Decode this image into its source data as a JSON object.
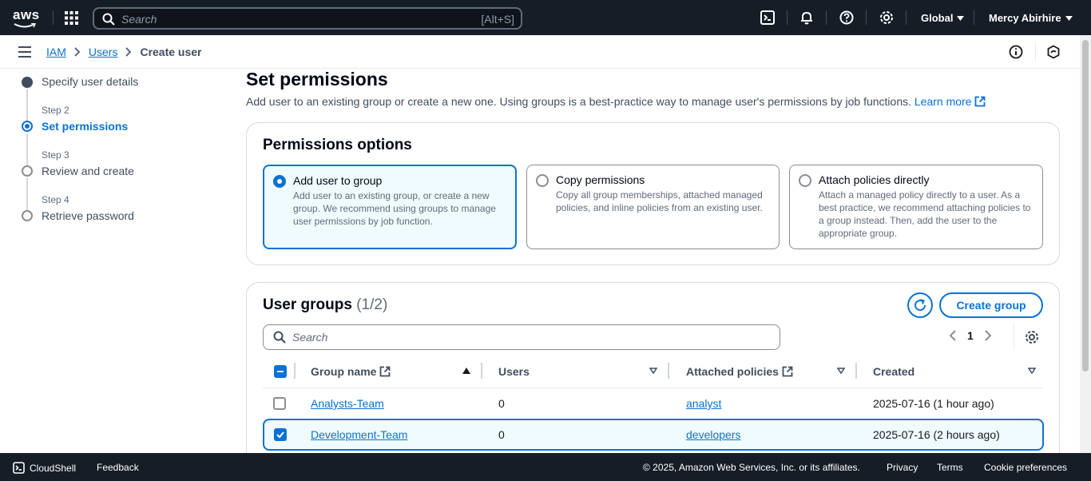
{
  "topnav": {
    "logo": "aws",
    "search_placeholder": "Search",
    "search_shortcut": "[Alt+S]",
    "region": "Global",
    "user": "Mercy Abirhire"
  },
  "breadcrumb": {
    "items": [
      "IAM",
      "Users"
    ],
    "current": "Create user"
  },
  "steps": {
    "step1_label": "Specify user details",
    "step2_small": "Step 2",
    "step2_label": "Set permissions",
    "step3_small": "Step 3",
    "step3_label": "Review and create",
    "step4_small": "Step 4",
    "step4_label": "Retrieve password"
  },
  "page": {
    "title": "Set permissions",
    "description": "Add user to an existing group or create a new one. Using groups is a best-practice way to manage user's permissions by job functions.",
    "learn_more": "Learn more"
  },
  "permissions": {
    "title": "Permissions options",
    "options": [
      {
        "title": "Add user to group",
        "desc": "Add user to an existing group, or create a new group. We recommend using groups to manage user permissions by job function.",
        "selected": true
      },
      {
        "title": "Copy permissions",
        "desc": "Copy all group memberships, attached managed policies, and inline policies from an existing user.",
        "selected": false
      },
      {
        "title": "Attach policies directly",
        "desc": "Attach a managed policy directly to a user. As a best practice, we recommend attaching policies to a group instead. Then, add the user to the appropriate group.",
        "selected": false
      }
    ]
  },
  "groups": {
    "title": "User groups",
    "count": "(1/2)",
    "create_button": "Create group",
    "search_placeholder": "Search",
    "page": "1",
    "columns": {
      "name": "Group name",
      "users": "Users",
      "policies": "Attached policies",
      "created": "Created"
    },
    "rows": [
      {
        "name": "Analysts-Team",
        "users": "0",
        "policy": "analyst",
        "created": "2025-07-16 (1 hour ago)",
        "checked": false
      },
      {
        "name": "Development-Team",
        "users": "0",
        "policy": "developers",
        "created": "2025-07-16 (2 hours ago)",
        "checked": true
      }
    ]
  },
  "footer": {
    "cloudshell": "CloudShell",
    "feedback": "Feedback",
    "copyright": "© 2025, Amazon Web Services, Inc. or its affiliates.",
    "privacy": "Privacy",
    "terms": "Terms",
    "cookies": "Cookie preferences"
  },
  "colors": {
    "nav_bg": "#161d26",
    "link": "#0972d3",
    "selected_bg": "#f0fbff"
  }
}
